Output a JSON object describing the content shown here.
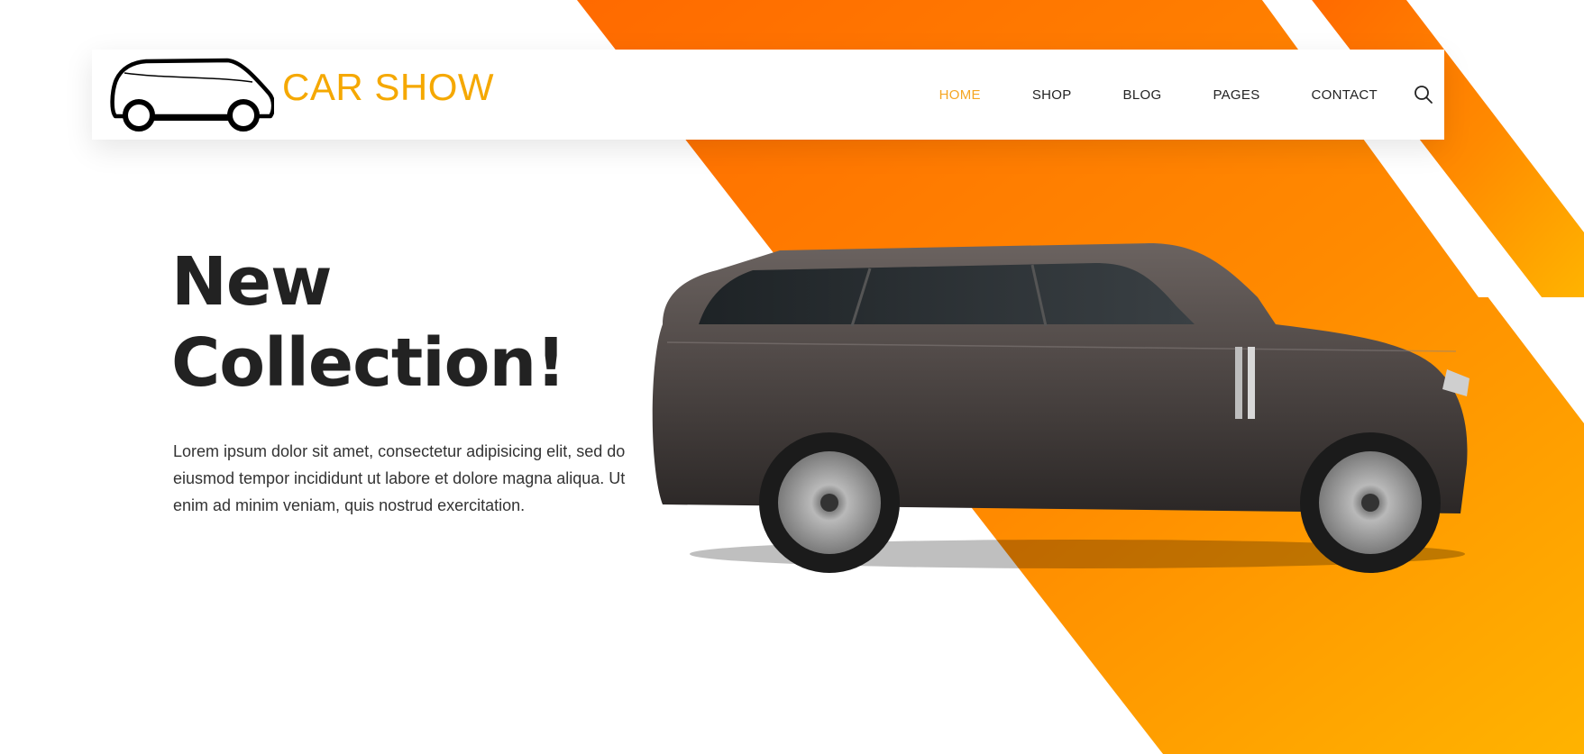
{
  "brand": {
    "name": "CAR SHOW",
    "color": "#f5a800",
    "logo_icon": "car-outline-icon"
  },
  "nav": {
    "items": [
      {
        "label": "HOME",
        "active": true
      },
      {
        "label": "SHOP",
        "active": false
      },
      {
        "label": "BLOG",
        "active": false
      },
      {
        "label": "PAGES",
        "active": false
      },
      {
        "label": "CONTACT",
        "active": false
      }
    ],
    "search_icon": "search-icon",
    "active_color": "#f5a623"
  },
  "hero": {
    "title_line1": "New",
    "title_line2": "Collection!",
    "text": "Lorem ipsum dolor sit amet, consectetur adipisicing elit, sed do eiusmod tempor incididunt ut labore et dolore magna aliqua. Ut enim ad minim veniam, quis nostrud exercitation.",
    "image": "dark-gray-suv-side-view"
  },
  "colors": {
    "stripe_orange": "#ff6a00",
    "stripe_yellow": "#ffb300",
    "text_dark": "#222222"
  }
}
